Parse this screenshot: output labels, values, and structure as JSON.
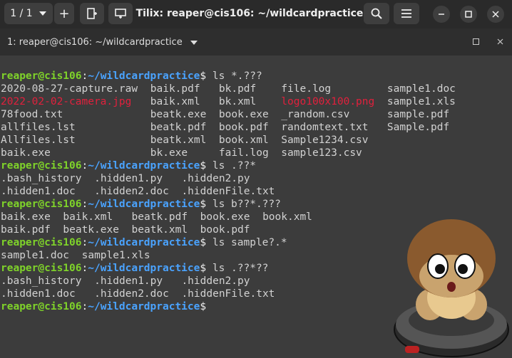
{
  "titlebar": {
    "session_label": "1 / 1",
    "plus": "+",
    "title": "Tilix: reaper@cis106: ~/wildcardpractice"
  },
  "tab": {
    "label": "1: reaper@cis106: ~/wildcardpractice"
  },
  "prompt": {
    "user": "reaper@cis106",
    "sep": ":",
    "path": "~/wildcardpractice",
    "dollar": "$"
  },
  "colors": {
    "user": "#7fd32a",
    "path": "#4aa3ff",
    "highlight": "#e1203c",
    "bg": "#3c3c3c"
  },
  "lines": [
    {
      "type": "prompt",
      "cmd": " ls *.???"
    },
    {
      "type": "out",
      "cols": [
        {
          "text": "2020-08-27-capture.raw",
          "col": 0
        },
        {
          "text": "baik.pdf",
          "col": 24
        },
        {
          "text": "bk.pdf",
          "col": 35
        },
        {
          "text": "file.log",
          "col": 45
        },
        {
          "text": "sample1.doc",
          "col": 62
        }
      ]
    },
    {
      "type": "out",
      "cols": [
        {
          "text": "2022-02-02-camera.jpg",
          "col": 0,
          "red": true
        },
        {
          "text": "baik.xml",
          "col": 24
        },
        {
          "text": "bk.xml",
          "col": 35
        },
        {
          "text": "logo100x100.png",
          "col": 45,
          "red": true
        },
        {
          "text": "sample1.xls",
          "col": 62
        }
      ]
    },
    {
      "type": "out",
      "cols": [
        {
          "text": "78food.txt",
          "col": 0
        },
        {
          "text": "beatk.exe",
          "col": 24
        },
        {
          "text": "book.exe",
          "col": 35
        },
        {
          "text": "_random.csv",
          "col": 45
        },
        {
          "text": "sample.pdf",
          "col": 62
        }
      ]
    },
    {
      "type": "out",
      "cols": [
        {
          "text": "allfiles.lst",
          "col": 0
        },
        {
          "text": "beatk.pdf",
          "col": 24
        },
        {
          "text": "book.pdf",
          "col": 35
        },
        {
          "text": "randomtext.txt",
          "col": 45
        },
        {
          "text": "Sample.pdf",
          "col": 62
        }
      ]
    },
    {
      "type": "out",
      "cols": [
        {
          "text": "Allfiles.lst",
          "col": 0
        },
        {
          "text": "beatk.xml",
          "col": 24
        },
        {
          "text": "book.xml",
          "col": 35
        },
        {
          "text": "Sample1234.csv",
          "col": 45
        }
      ]
    },
    {
      "type": "out",
      "cols": [
        {
          "text": "baik.exe",
          "col": 0
        },
        {
          "text": "bk.exe",
          "col": 24
        },
        {
          "text": "fail.log",
          "col": 35
        },
        {
          "text": "sample123.csv",
          "col": 45
        }
      ]
    },
    {
      "type": "prompt",
      "cmd": " ls .??*"
    },
    {
      "type": "out",
      "cols": [
        {
          "text": ".bash_history",
          "col": 0
        },
        {
          "text": ".hidden1.py",
          "col": 15
        },
        {
          "text": ".hidden2.py",
          "col": 29
        }
      ]
    },
    {
      "type": "out",
      "cols": [
        {
          "text": ".hidden1.doc",
          "col": 0
        },
        {
          "text": ".hidden2.doc",
          "col": 15
        },
        {
          "text": ".hiddenFile.txt",
          "col": 29
        }
      ]
    },
    {
      "type": "prompt",
      "cmd": " ls b??*.???"
    },
    {
      "type": "out",
      "cols": [
        {
          "text": "baik.exe",
          "col": 0
        },
        {
          "text": "baik.xml",
          "col": 10
        },
        {
          "text": "beatk.pdf",
          "col": 21
        },
        {
          "text": "book.exe",
          "col": 32
        },
        {
          "text": "book.xml",
          "col": 42
        }
      ]
    },
    {
      "type": "out",
      "cols": [
        {
          "text": "baik.pdf",
          "col": 0
        },
        {
          "text": "beatk.exe",
          "col": 10
        },
        {
          "text": "beatk.xml",
          "col": 21
        },
        {
          "text": "book.pdf",
          "col": 32
        }
      ]
    },
    {
      "type": "prompt",
      "cmd": " ls sample?.*"
    },
    {
      "type": "out",
      "cols": [
        {
          "text": "sample1.doc",
          "col": 0
        },
        {
          "text": "sample1.xls",
          "col": 13
        }
      ]
    },
    {
      "type": "prompt",
      "cmd": " ls .??*??"
    },
    {
      "type": "out",
      "cols": [
        {
          "text": ".bash_history",
          "col": 0
        },
        {
          "text": ".hidden1.py",
          "col": 15
        },
        {
          "text": ".hidden2.py",
          "col": 29
        }
      ]
    },
    {
      "type": "out",
      "cols": [
        {
          "text": ".hidden1.doc",
          "col": 0
        },
        {
          "text": ".hidden2.doc",
          "col": 15
        },
        {
          "text": ".hiddenFile.txt",
          "col": 29
        }
      ]
    },
    {
      "type": "prompt",
      "cmd": ""
    }
  ]
}
